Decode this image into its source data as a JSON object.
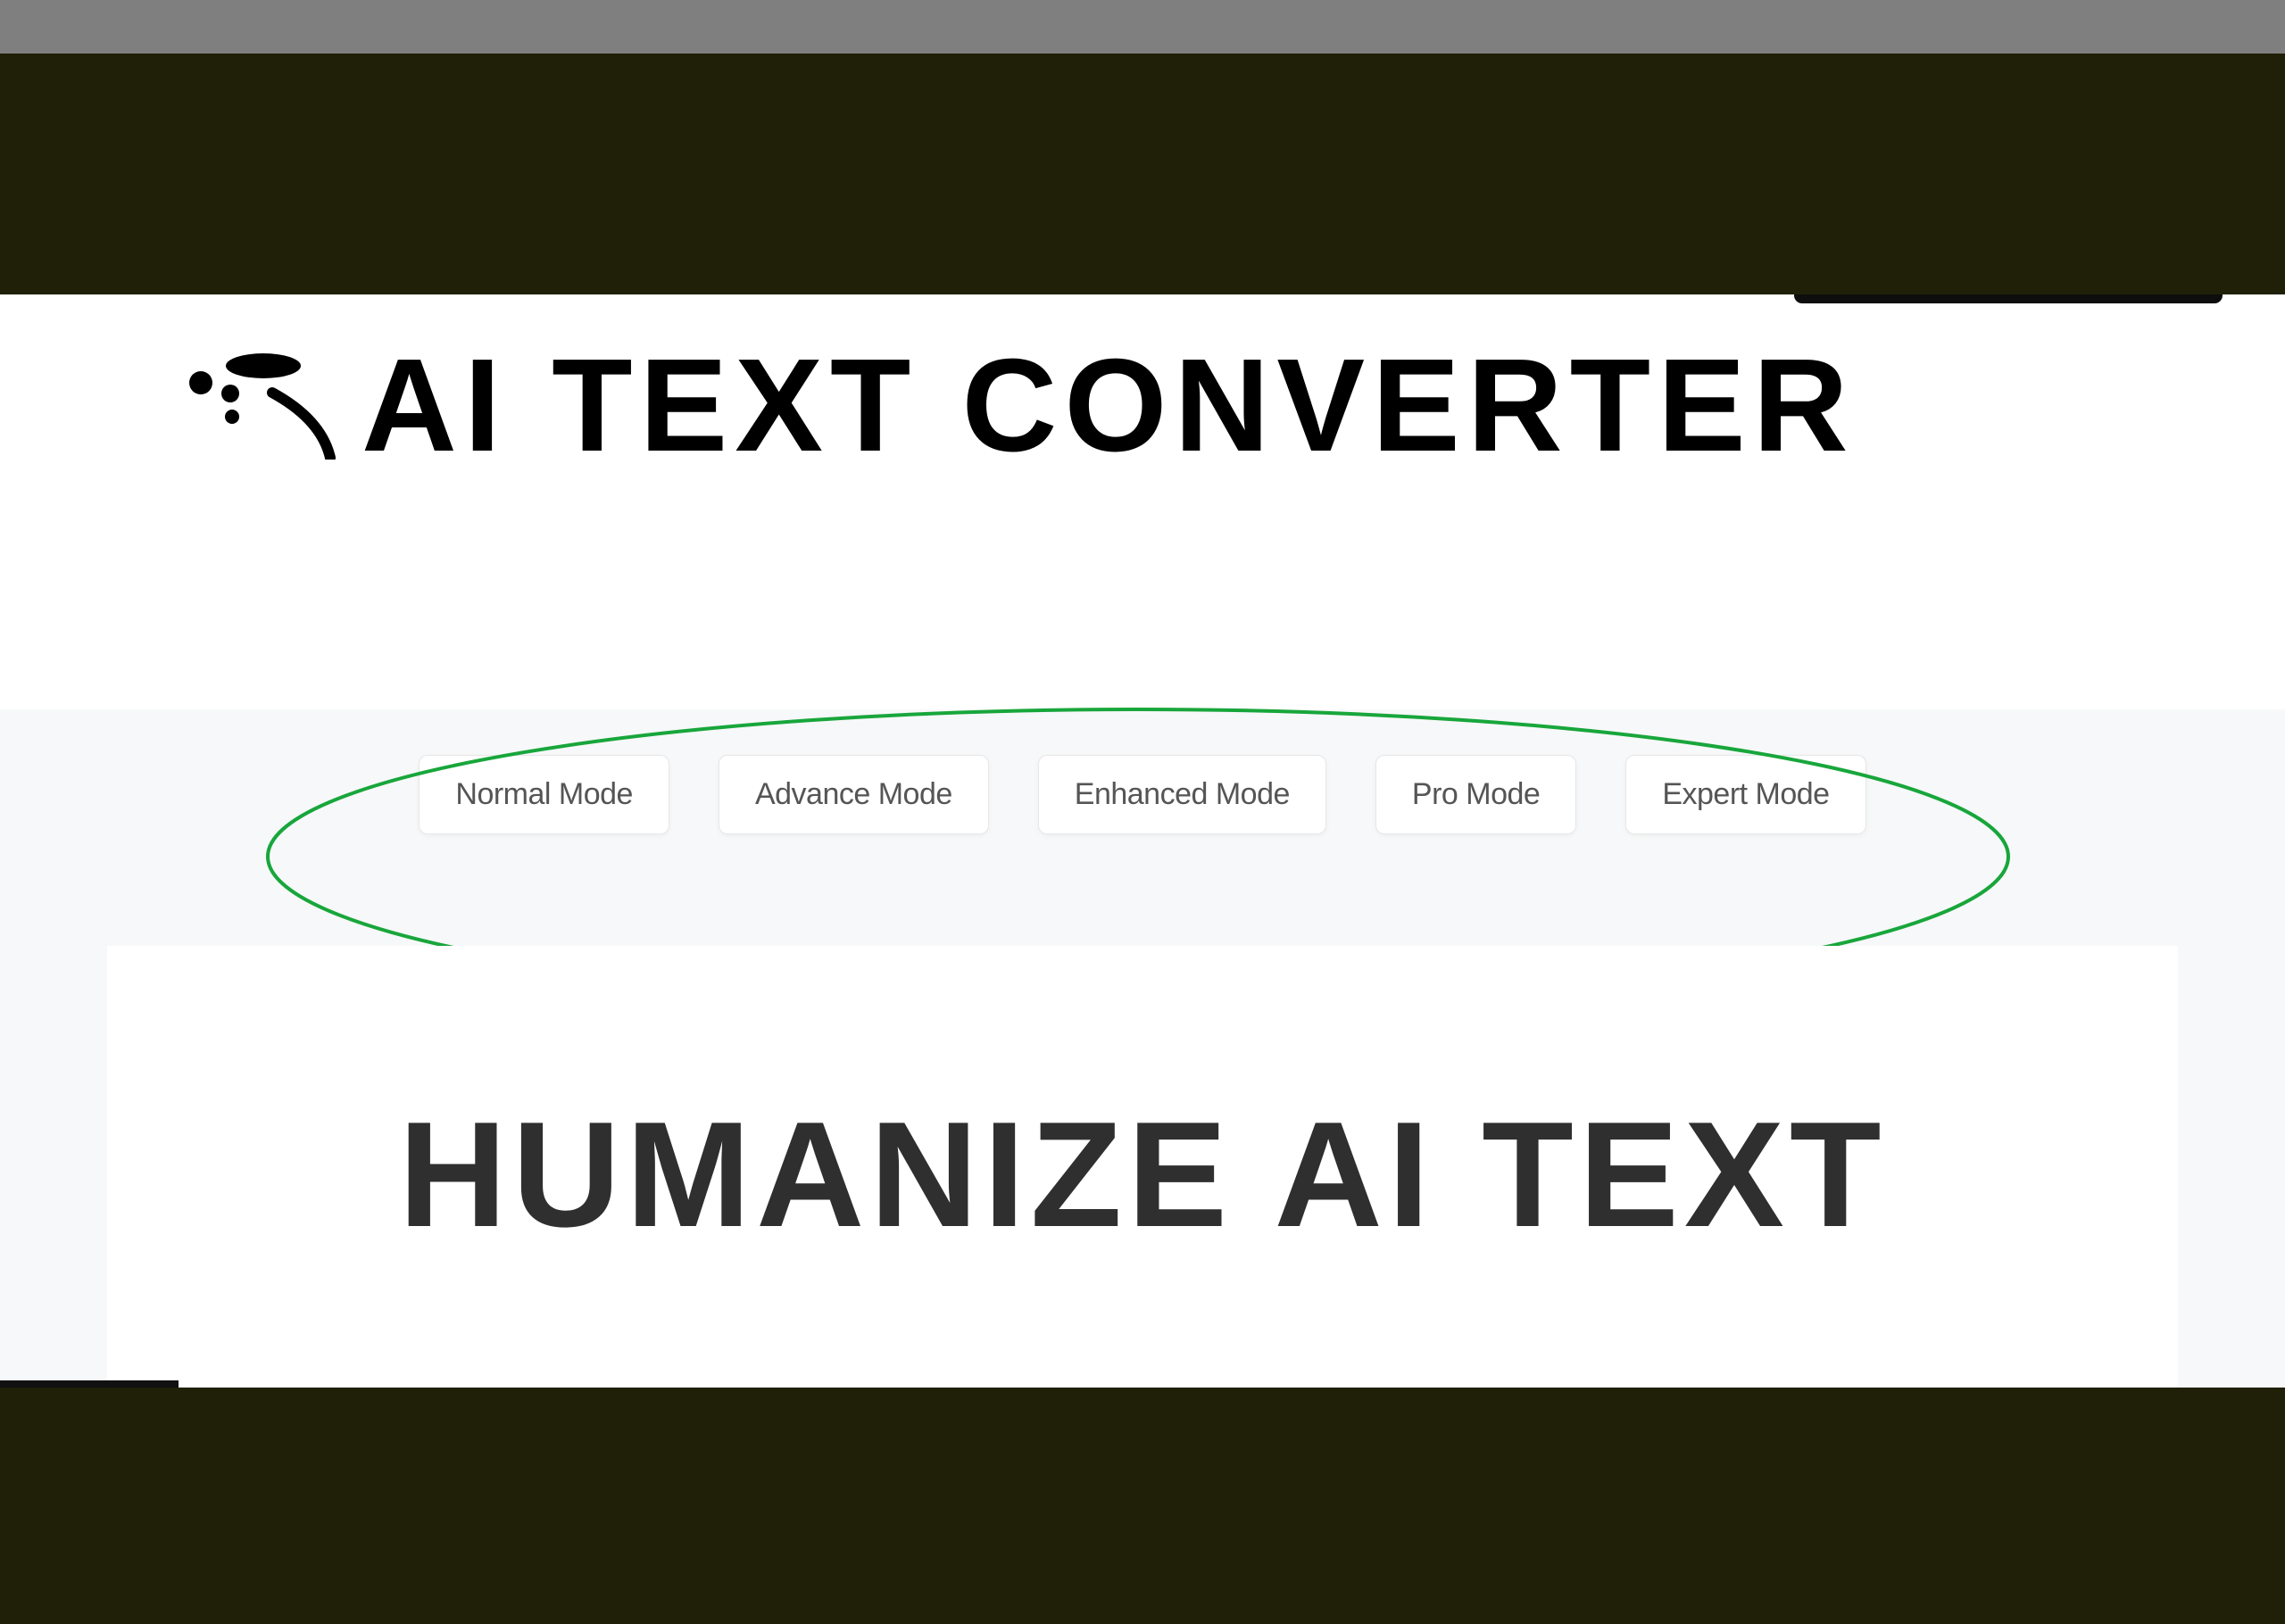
{
  "brand": {
    "title": "AI TEXT CONVERTER"
  },
  "modes": {
    "items": [
      {
        "label": "Normal Mode"
      },
      {
        "label": "Advance Mode"
      },
      {
        "label": "Enhanced Mode"
      },
      {
        "label": "Pro Mode"
      },
      {
        "label": "Expert Mode"
      }
    ]
  },
  "hero": {
    "headline": "HUMANIZE AI TEXT"
  }
}
